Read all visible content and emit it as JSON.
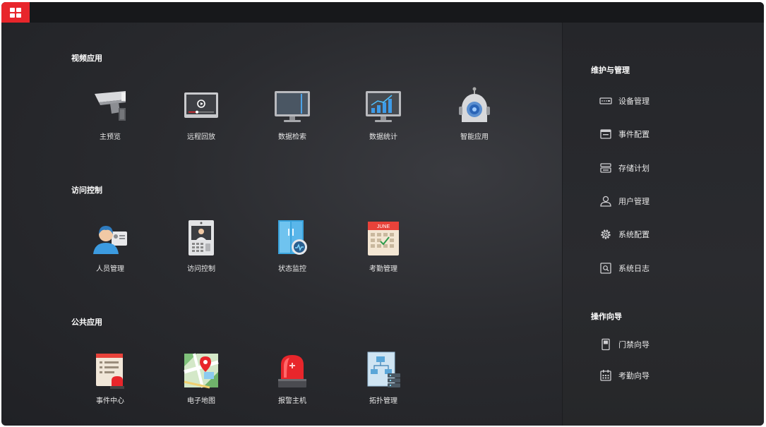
{
  "sections": {
    "video": {
      "title": "视频应用",
      "items": [
        "主预览",
        "远程回放",
        "数据检索",
        "数据统计",
        "智能应用"
      ]
    },
    "access": {
      "title": "访问控制",
      "items": [
        "人员管理",
        "访问控制",
        "状态监控",
        "考勤管理"
      ]
    },
    "public": {
      "title": "公共应用",
      "items": [
        "事件中心",
        "电子地图",
        "报警主机",
        "拓扑管理"
      ]
    }
  },
  "right_panel": {
    "maintenance": {
      "title": "维护与管理",
      "items": [
        "设备管理",
        "事件配置",
        "存储计划",
        "用户管理",
        "系统配置",
        "系统日志"
      ]
    },
    "wizard": {
      "title": "操作向导",
      "items": [
        "门禁向导",
        "考勤向导"
      ]
    }
  },
  "calendar_month": "JUNE",
  "colors": {
    "accent": "#e8262b",
    "background": "#2a2b2f"
  }
}
